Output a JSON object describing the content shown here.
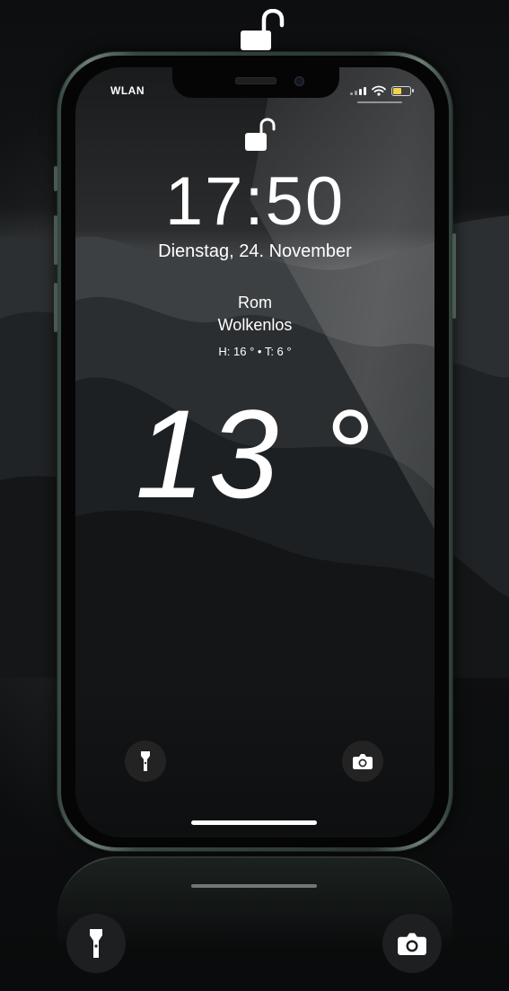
{
  "status_bar": {
    "network_label": "WLAN",
    "signal_icon": "cellular-signal-icon",
    "wifi_icon": "wifi-icon",
    "battery_icon": "battery-icon",
    "battery_level": 0.55,
    "battery_color": "#f0d34a"
  },
  "lock_screen": {
    "lock_icon": "unlocked-padlock-icon",
    "time": "17:50",
    "date": "Dienstag, 24. November"
  },
  "weather": {
    "city": "Rom",
    "condition": "Wolkenlos",
    "high_low": "H: 16 ° • T: 6 °",
    "temperature": "13 °"
  },
  "quick_actions": {
    "flashlight_icon": "flashlight-icon",
    "camera_icon": "camera-icon"
  },
  "decorations": {
    "top_lock_icon": "unlocked-padlock-icon",
    "accent_color": "#6f8279"
  }
}
